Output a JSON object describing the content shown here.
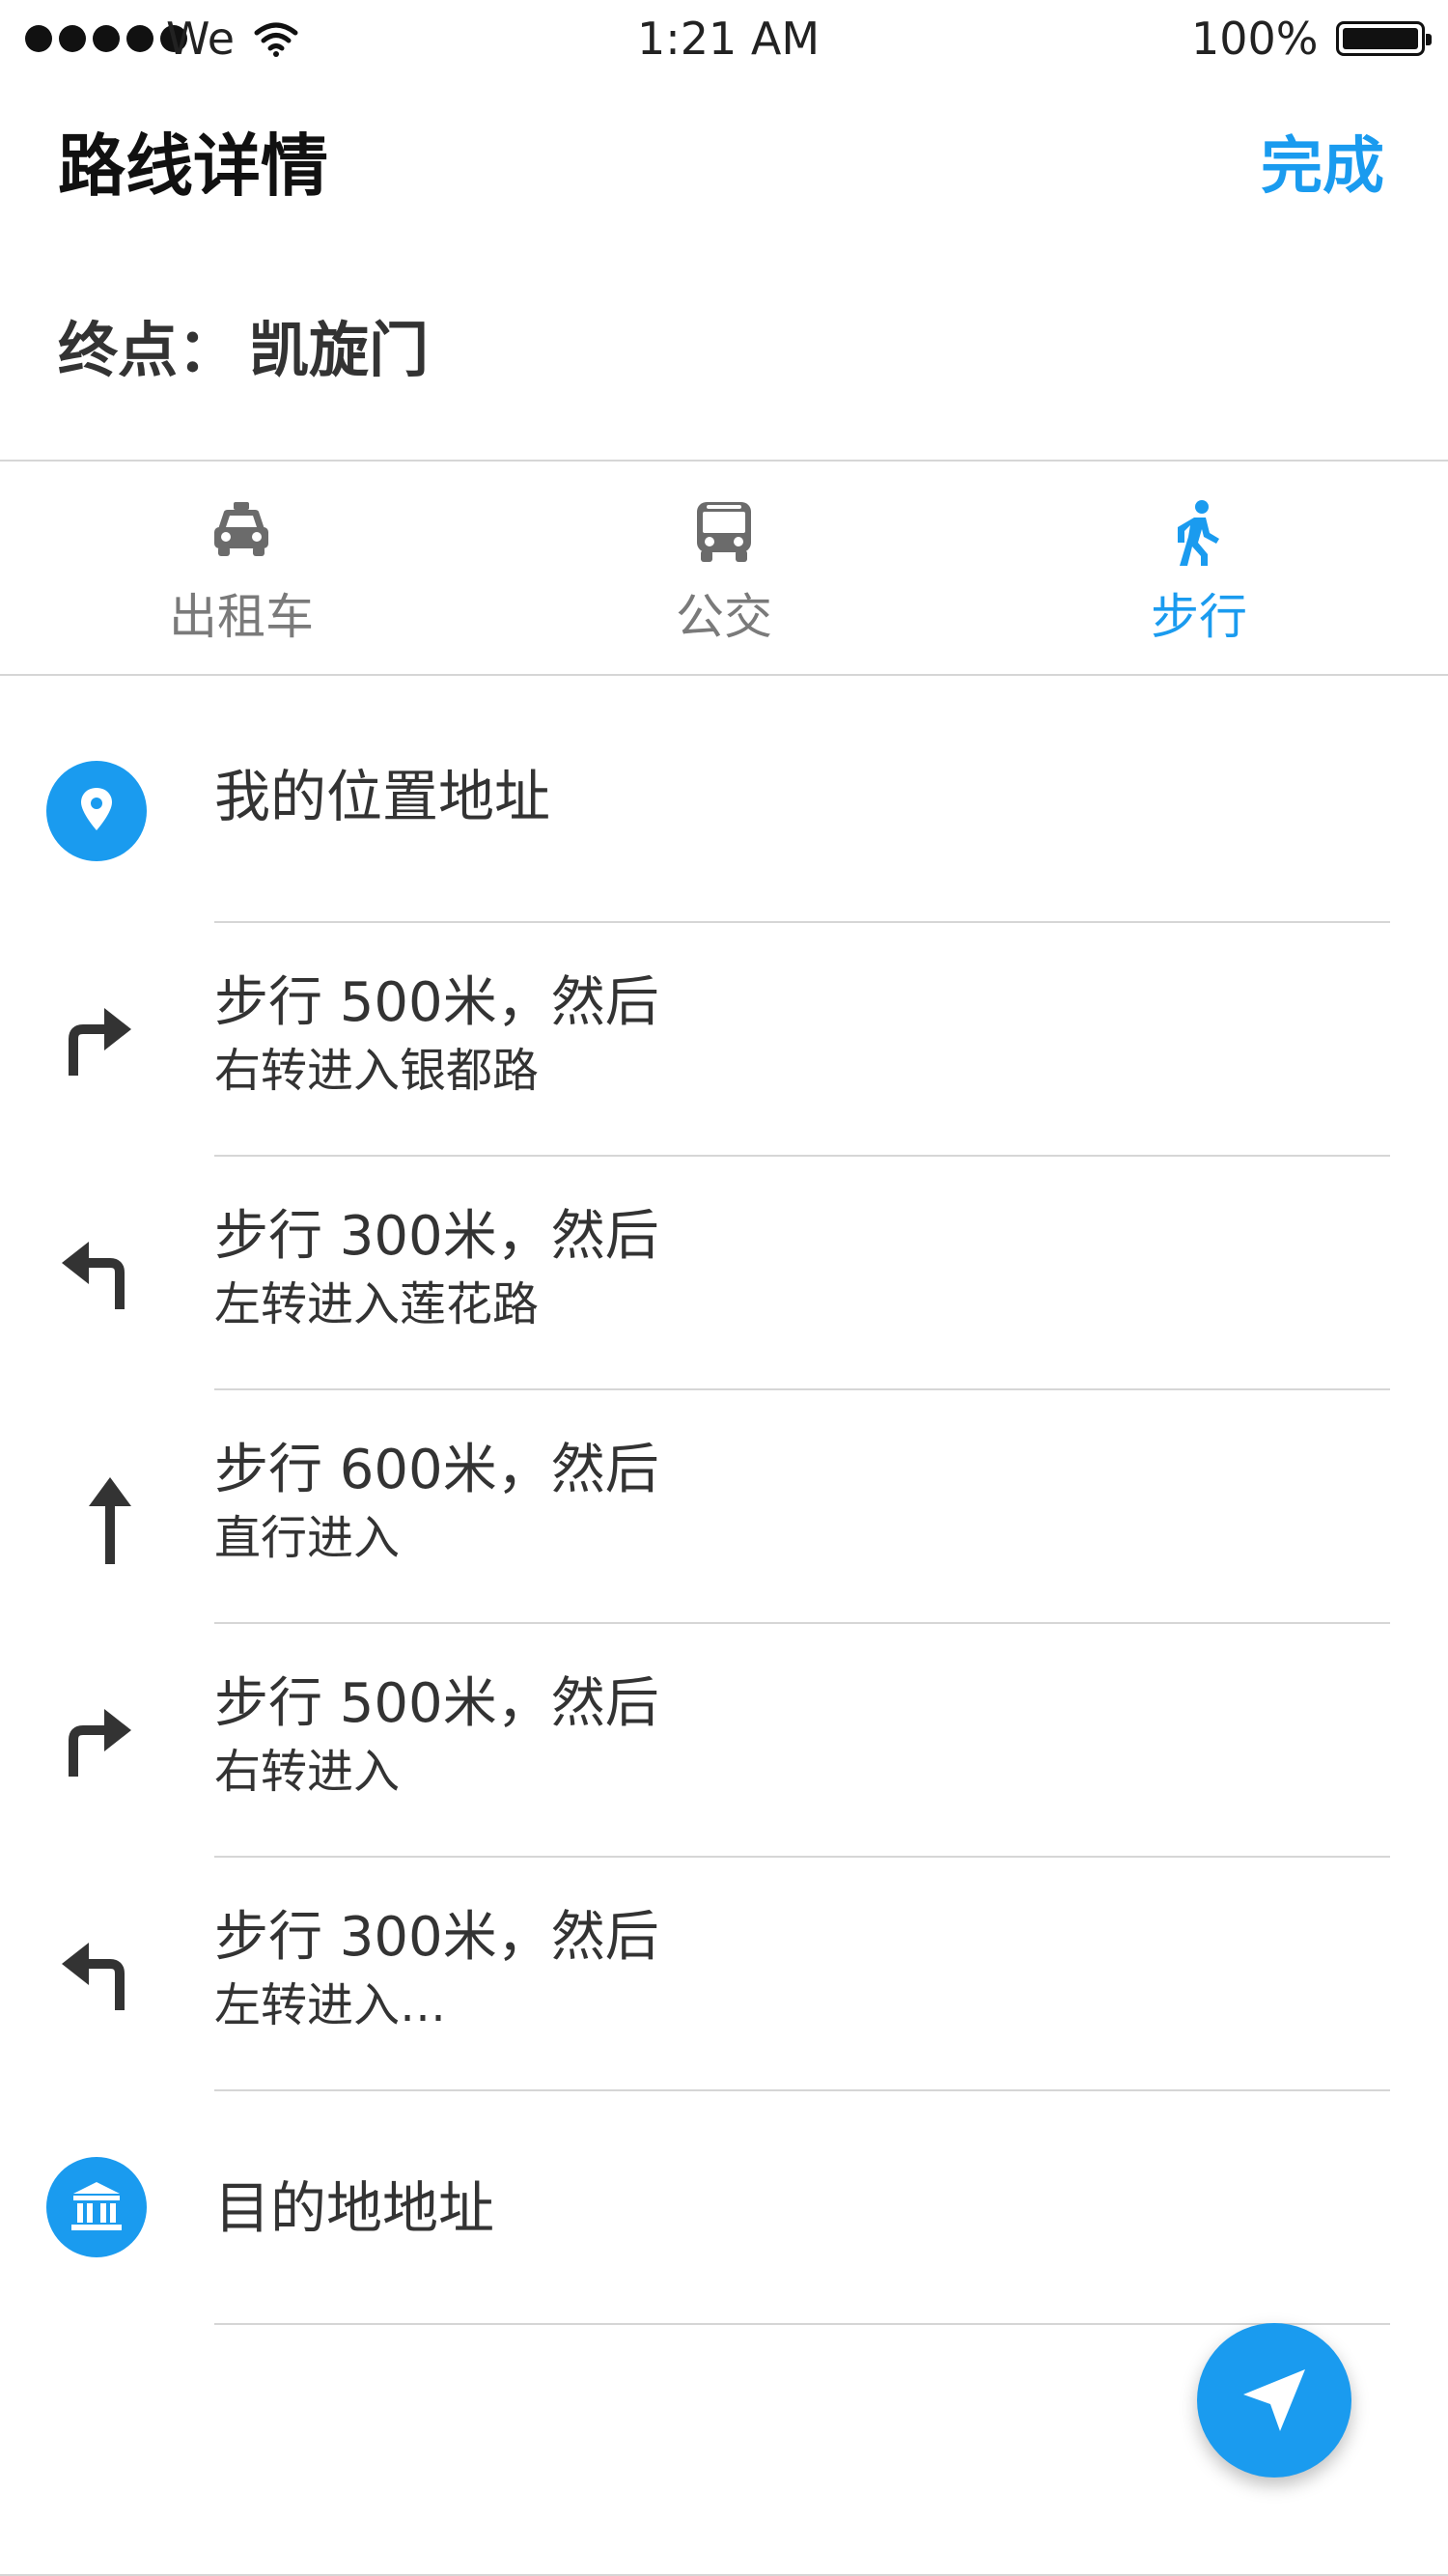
{
  "status_bar": {
    "carrier": "We",
    "time": "1:21 AM",
    "battery": "100%"
  },
  "header": {
    "title": "路线详情",
    "done_label": "完成"
  },
  "destination": {
    "label": "终点：",
    "value": "凯旋门"
  },
  "tabs": [
    {
      "label": "出租车",
      "icon": "taxi-icon",
      "active": false
    },
    {
      "label": "公交",
      "icon": "bus-icon",
      "active": false
    },
    {
      "label": "步行",
      "icon": "walk-icon",
      "active": true
    }
  ],
  "route": {
    "start": "我的位置地址",
    "steps": [
      {
        "main": "步行 500米，然后",
        "sub": "右转进入银都路",
        "icon": "turn-right-icon"
      },
      {
        "main": "步行 300米，然后",
        "sub": "左转进入莲花路",
        "icon": "turn-left-icon"
      },
      {
        "main": "步行 600米，然后",
        "sub": "直行进入",
        "icon": "straight-arrow-icon"
      },
      {
        "main": "步行 500米，然后",
        "sub": "右转进入",
        "icon": "turn-right-icon"
      },
      {
        "main": "步行 300米，然后",
        "sub": "左转进入…",
        "icon": "turn-left-icon"
      }
    ],
    "end": "目的地地址"
  },
  "colors": {
    "accent": "#1a9bef",
    "text": "#333333",
    "divider": "#d6d6d6"
  },
  "fab_icon": "navigate-icon"
}
